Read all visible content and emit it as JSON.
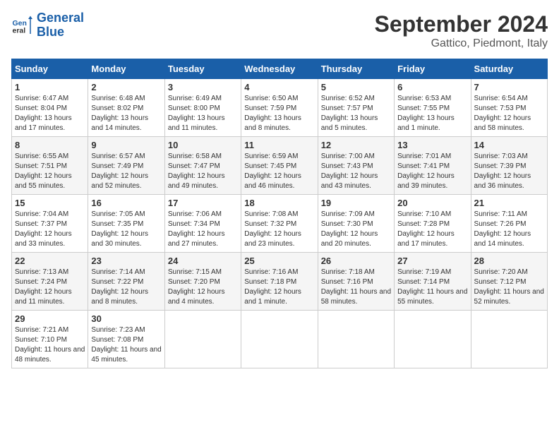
{
  "logo": {
    "line1": "General",
    "line2": "Blue"
  },
  "header": {
    "month": "September 2024",
    "location": "Gattico, Piedmont, Italy"
  },
  "weekdays": [
    "Sunday",
    "Monday",
    "Tuesday",
    "Wednesday",
    "Thursday",
    "Friday",
    "Saturday"
  ],
  "weeks": [
    [
      {
        "day": 1,
        "sunrise": "6:47 AM",
        "sunset": "8:04 PM",
        "daylight": "13 hours and 17 minutes."
      },
      {
        "day": 2,
        "sunrise": "6:48 AM",
        "sunset": "8:02 PM",
        "daylight": "13 hours and 14 minutes."
      },
      {
        "day": 3,
        "sunrise": "6:49 AM",
        "sunset": "8:00 PM",
        "daylight": "13 hours and 11 minutes."
      },
      {
        "day": 4,
        "sunrise": "6:50 AM",
        "sunset": "7:59 PM",
        "daylight": "13 hours and 8 minutes."
      },
      {
        "day": 5,
        "sunrise": "6:52 AM",
        "sunset": "7:57 PM",
        "daylight": "13 hours and 5 minutes."
      },
      {
        "day": 6,
        "sunrise": "6:53 AM",
        "sunset": "7:55 PM",
        "daylight": "13 hours and 1 minute."
      },
      {
        "day": 7,
        "sunrise": "6:54 AM",
        "sunset": "7:53 PM",
        "daylight": "12 hours and 58 minutes."
      }
    ],
    [
      {
        "day": 8,
        "sunrise": "6:55 AM",
        "sunset": "7:51 PM",
        "daylight": "12 hours and 55 minutes."
      },
      {
        "day": 9,
        "sunrise": "6:57 AM",
        "sunset": "7:49 PM",
        "daylight": "12 hours and 52 minutes."
      },
      {
        "day": 10,
        "sunrise": "6:58 AM",
        "sunset": "7:47 PM",
        "daylight": "12 hours and 49 minutes."
      },
      {
        "day": 11,
        "sunrise": "6:59 AM",
        "sunset": "7:45 PM",
        "daylight": "12 hours and 46 minutes."
      },
      {
        "day": 12,
        "sunrise": "7:00 AM",
        "sunset": "7:43 PM",
        "daylight": "12 hours and 43 minutes."
      },
      {
        "day": 13,
        "sunrise": "7:01 AM",
        "sunset": "7:41 PM",
        "daylight": "12 hours and 39 minutes."
      },
      {
        "day": 14,
        "sunrise": "7:03 AM",
        "sunset": "7:39 PM",
        "daylight": "12 hours and 36 minutes."
      }
    ],
    [
      {
        "day": 15,
        "sunrise": "7:04 AM",
        "sunset": "7:37 PM",
        "daylight": "12 hours and 33 minutes."
      },
      {
        "day": 16,
        "sunrise": "7:05 AM",
        "sunset": "7:35 PM",
        "daylight": "12 hours and 30 minutes."
      },
      {
        "day": 17,
        "sunrise": "7:06 AM",
        "sunset": "7:34 PM",
        "daylight": "12 hours and 27 minutes."
      },
      {
        "day": 18,
        "sunrise": "7:08 AM",
        "sunset": "7:32 PM",
        "daylight": "12 hours and 23 minutes."
      },
      {
        "day": 19,
        "sunrise": "7:09 AM",
        "sunset": "7:30 PM",
        "daylight": "12 hours and 20 minutes."
      },
      {
        "day": 20,
        "sunrise": "7:10 AM",
        "sunset": "7:28 PM",
        "daylight": "12 hours and 17 minutes."
      },
      {
        "day": 21,
        "sunrise": "7:11 AM",
        "sunset": "7:26 PM",
        "daylight": "12 hours and 14 minutes."
      }
    ],
    [
      {
        "day": 22,
        "sunrise": "7:13 AM",
        "sunset": "7:24 PM",
        "daylight": "12 hours and 11 minutes."
      },
      {
        "day": 23,
        "sunrise": "7:14 AM",
        "sunset": "7:22 PM",
        "daylight": "12 hours and 8 minutes."
      },
      {
        "day": 24,
        "sunrise": "7:15 AM",
        "sunset": "7:20 PM",
        "daylight": "12 hours and 4 minutes."
      },
      {
        "day": 25,
        "sunrise": "7:16 AM",
        "sunset": "7:18 PM",
        "daylight": "12 hours and 1 minute."
      },
      {
        "day": 26,
        "sunrise": "7:18 AM",
        "sunset": "7:16 PM",
        "daylight": "11 hours and 58 minutes."
      },
      {
        "day": 27,
        "sunrise": "7:19 AM",
        "sunset": "7:14 PM",
        "daylight": "11 hours and 55 minutes."
      },
      {
        "day": 28,
        "sunrise": "7:20 AM",
        "sunset": "7:12 PM",
        "daylight": "11 hours and 52 minutes."
      }
    ],
    [
      {
        "day": 29,
        "sunrise": "7:21 AM",
        "sunset": "7:10 PM",
        "daylight": "11 hours and 48 minutes."
      },
      {
        "day": 30,
        "sunrise": "7:23 AM",
        "sunset": "7:08 PM",
        "daylight": "11 hours and 45 minutes."
      },
      null,
      null,
      null,
      null,
      null
    ]
  ]
}
